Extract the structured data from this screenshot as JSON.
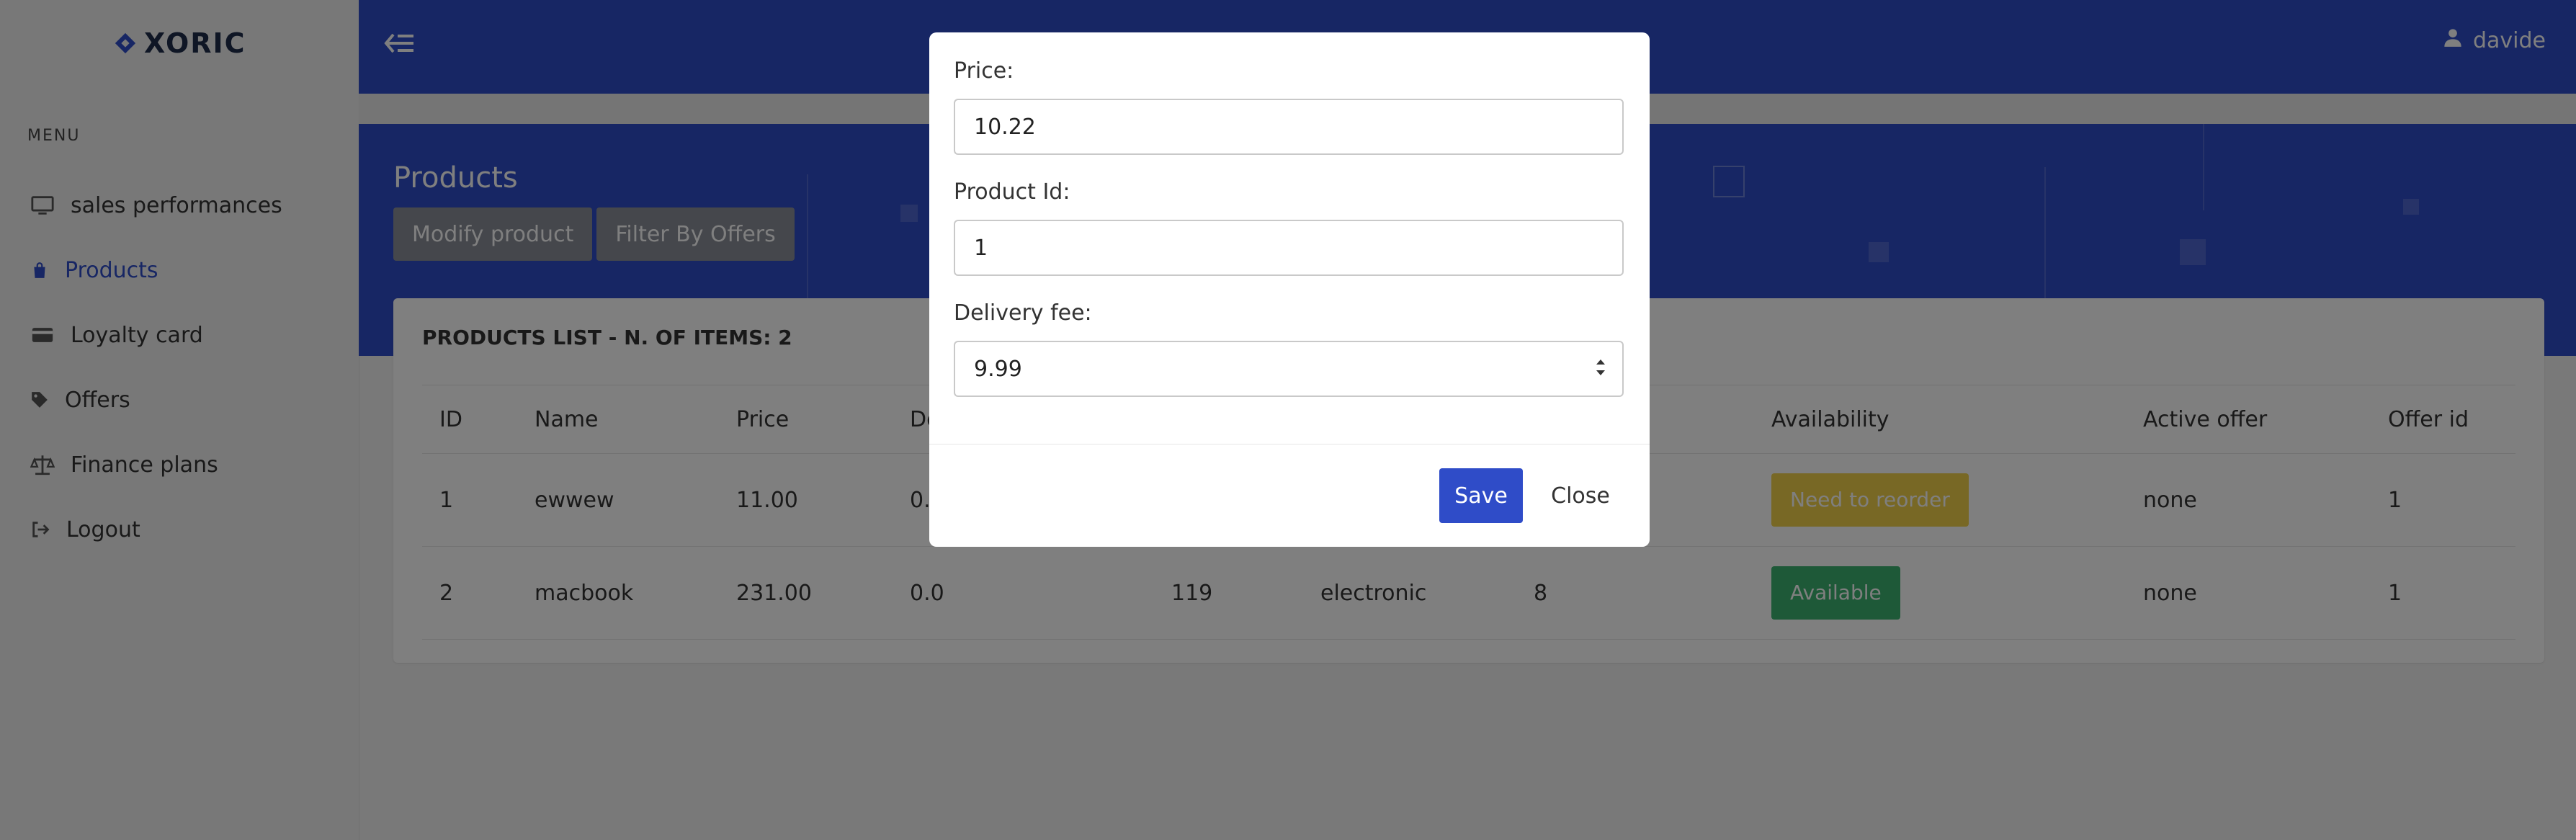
{
  "brand": {
    "name": "XORIC"
  },
  "sidebar": {
    "menu_title": "MENU",
    "items": [
      {
        "label": "sales performances",
        "icon": "monitor-icon",
        "active": false
      },
      {
        "label": "Products",
        "icon": "shopping-bag-icon",
        "active": true
      },
      {
        "label": "Loyalty card",
        "icon": "credit-card-icon",
        "active": false
      },
      {
        "label": "Offers",
        "icon": "tag-icon",
        "active": false
      },
      {
        "label": "Finance plans",
        "icon": "balance-scale-icon",
        "active": false
      },
      {
        "label": "Logout",
        "icon": "logout-icon",
        "active": false
      }
    ]
  },
  "header": {
    "user": "davide",
    "toggle_icon": "collapse-sidebar-icon"
  },
  "page": {
    "title": "Products",
    "buttons": {
      "modify": "Modify product",
      "filter": "Filter By Offers"
    }
  },
  "products": {
    "title": "PRODUCTS LIST - N. OF ITEMS: 2",
    "columns": [
      "ID",
      "Name",
      "Price",
      "De",
      "",
      "",
      "",
      "Availability",
      "Active offer",
      "Offer id"
    ],
    "rows": [
      {
        "id": "1",
        "name": "ewwew",
        "price": "11.00",
        "delivery": "0.0",
        "col5": "",
        "col6": "",
        "col7": "",
        "availability": "Need to reorder",
        "active_offer": "none",
        "offer_id": "1"
      },
      {
        "id": "2",
        "name": "macbook",
        "price": "231.00",
        "delivery": "0.0",
        "col5": "119",
        "col6": "electronic",
        "col7": "8",
        "availability": "Available",
        "active_offer": "none",
        "offer_id": "1"
      }
    ]
  },
  "modal": {
    "price_label": "Price:",
    "price_value": "10.22",
    "product_id_label": "Product Id:",
    "product_id_value": "1",
    "delivery_label": "Delivery fee:",
    "delivery_value": "9.99",
    "save": "Save",
    "close": "Close"
  },
  "colors": {
    "primary": "#2f4cc8",
    "badge_reorder": "#f0d04a",
    "badge_available": "#3cb371",
    "button_grey": "#8b8f99"
  }
}
